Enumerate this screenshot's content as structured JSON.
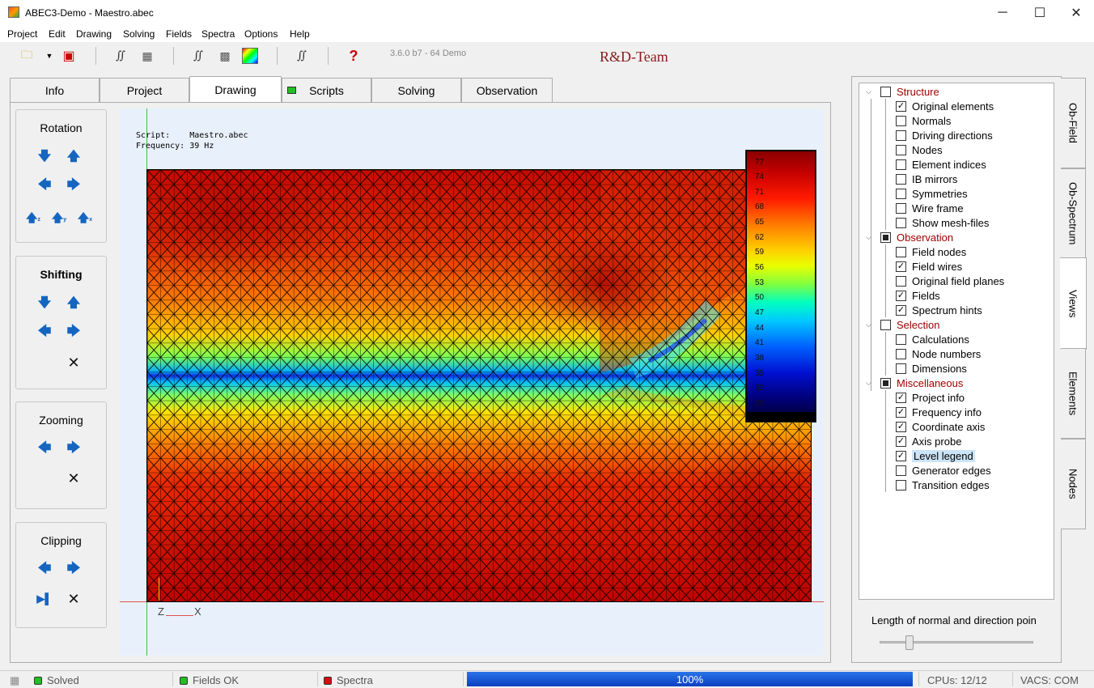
{
  "window": {
    "title": "ABEC3-Demo - Maestro.abec",
    "minimize": "─",
    "maximize": "☐",
    "close": "✕"
  },
  "menu": [
    "Project",
    "Edit",
    "Drawing",
    "Solving",
    "Fields",
    "Spectra",
    "Options",
    "Help"
  ],
  "toolbar": {
    "version": "3.6.0 b7 - 64 Demo",
    "team": "R&D-Team"
  },
  "tabs": [
    "Info",
    "Project",
    "Drawing",
    "Scripts",
    "Solving",
    "Observation"
  ],
  "active_tab": "Drawing",
  "controls": {
    "rotation": "Rotation",
    "shifting": "Shifting",
    "zooming": "Zooming",
    "clipping": "Clipping"
  },
  "canvas": {
    "script_label": "Script:",
    "script_value": "Maestro.abec",
    "frequency_label": "Frequency:",
    "frequency_value": "39 Hz",
    "axis_z": "Z",
    "axis_x": "X"
  },
  "legend": {
    "levels": [
      "77",
      "74",
      "71",
      "68",
      "65",
      "62",
      "59",
      "56",
      "53",
      "50",
      "47",
      "44",
      "41",
      "38",
      "35",
      "32",
      "29"
    ]
  },
  "tree": [
    {
      "label": "Structure",
      "group": true,
      "state": "unchecked"
    },
    {
      "label": "Original elements",
      "state": "checked"
    },
    {
      "label": "Normals",
      "state": "unchecked"
    },
    {
      "label": "Driving directions",
      "state": "unchecked"
    },
    {
      "label": "Nodes",
      "state": "unchecked"
    },
    {
      "label": "Element indices",
      "state": "unchecked"
    },
    {
      "label": "IB mirrors",
      "state": "unchecked"
    },
    {
      "label": "Symmetries",
      "state": "unchecked"
    },
    {
      "label": "Wire frame",
      "state": "unchecked"
    },
    {
      "label": "Show mesh-files",
      "state": "unchecked"
    },
    {
      "label": "Observation",
      "group": true,
      "state": "partial"
    },
    {
      "label": "Field nodes",
      "state": "unchecked"
    },
    {
      "label": "Field wires",
      "state": "checked"
    },
    {
      "label": "Original field planes",
      "state": "unchecked"
    },
    {
      "label": "Fields",
      "state": "checked"
    },
    {
      "label": "Spectrum hints",
      "state": "checked"
    },
    {
      "label": "Selection",
      "group": true,
      "state": "unchecked"
    },
    {
      "label": "Calculations",
      "state": "unchecked"
    },
    {
      "label": "Node numbers",
      "state": "unchecked"
    },
    {
      "label": "Dimensions",
      "state": "unchecked"
    },
    {
      "label": "Miscellaneous",
      "group": true,
      "state": "partial"
    },
    {
      "label": "Project info",
      "state": "checked"
    },
    {
      "label": "Frequency info",
      "state": "checked"
    },
    {
      "label": "Coordinate axis",
      "state": "checked"
    },
    {
      "label": "Axis probe",
      "state": "checked"
    },
    {
      "label": "Level legend",
      "state": "checked",
      "selected": true
    },
    {
      "label": "Generator edges",
      "state": "unchecked"
    },
    {
      "label": "Transition edges",
      "state": "unchecked"
    }
  ],
  "right_panel": {
    "length_label": "Length of normal and direction poin"
  },
  "side_tabs": [
    "Ob-Field",
    "Ob-Spectrum",
    "Views",
    "Elements",
    "Nodes"
  ],
  "active_side_tab": "Views",
  "status": {
    "solved": "Solved",
    "fields": "Fields OK",
    "spectra": "Spectra",
    "progress": 100,
    "progress_text": "100%",
    "cpus": "CPUs: 12/12",
    "vacs": "VACS: COM"
  },
  "colors": {
    "ok": "#22c022",
    "error": "#d01010",
    "group": "#a00000",
    "progress": "#0a3fc0"
  }
}
